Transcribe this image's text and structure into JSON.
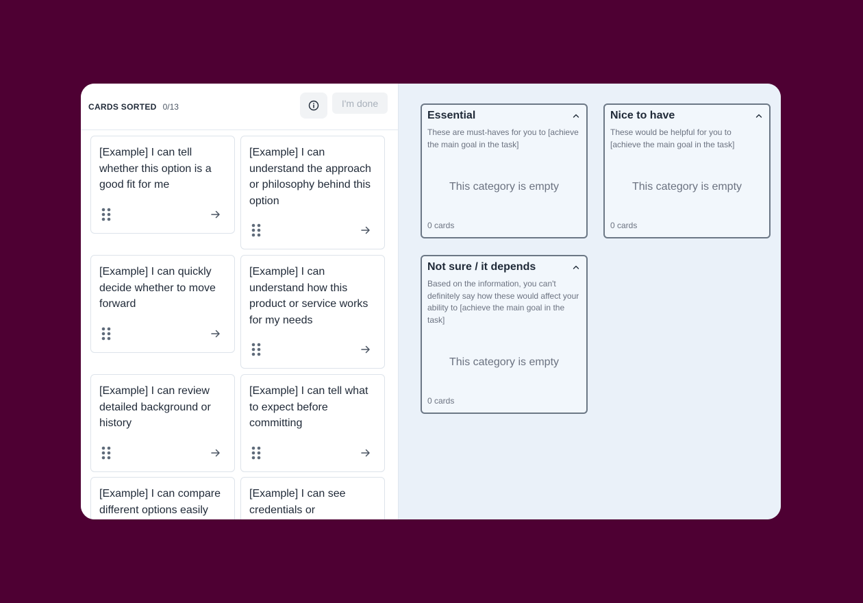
{
  "header": {
    "sorted_label": "CARDS SORTED",
    "sorted_count": "0/13",
    "done_label": "I'm done",
    "info_icon": "info-icon"
  },
  "cards": [
    {
      "text": "[Example] I can tell whether this option is a good fit for me"
    },
    {
      "text": "[Example] I can understand the approach or philosophy behind this option"
    },
    {
      "text": "[Example] I can quickly decide whether to move forward"
    },
    {
      "text": "[Example] I can understand how this product or service works for my needs"
    },
    {
      "text": "[Example] I can review detailed background or history"
    },
    {
      "text": "[Example] I can tell what to expect before committing"
    },
    {
      "text": "[Example] I can compare different options easily"
    },
    {
      "text": "[Example] I can see credentials or"
    }
  ],
  "categories": [
    {
      "title": "Essential",
      "description": "These are must-haves for you to [achieve the main goal in the task]",
      "empty_text": "This category is empty",
      "count": "0 cards"
    },
    {
      "title": "Nice to have",
      "description": "These would be helpful for you to [achieve the main goal in the task]",
      "empty_text": "This category is empty",
      "count": "0 cards"
    },
    {
      "title": "Not sure / it depends",
      "description": "Based on the information, you can't definitely say how these would affect your ability to [achieve the main goal in the task]",
      "empty_text": "This category is empty",
      "count": "0 cards"
    }
  ],
  "colors": {
    "page_background": "#4e0033",
    "panel_background": "#eaf1f9",
    "category_border": "#6b7785"
  }
}
